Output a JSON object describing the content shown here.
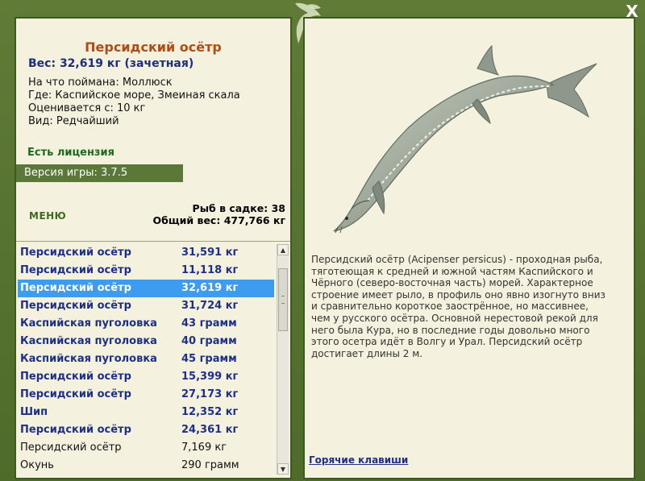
{
  "fish_card": {
    "title": "Персидский осётр",
    "weight": "Вес: 32,619 кг (зачетная)",
    "caught_on": "На что поймана: Моллюск",
    "location": "Где: Каспийское море, Змеиная скала",
    "valued_from": "Оценивается с: 10 кг",
    "kind": "Вид: Редчайший"
  },
  "license": "Есть лицензия",
  "version": "Версия игры: 3.7.5",
  "menu_label": "МЕНЮ",
  "stats": {
    "fish_count": "Рыб в садке: 38",
    "total_weight": "Общий вес: 477,766 кг"
  },
  "catch_list": [
    {
      "name": "Персидский осётр",
      "weight": "31,591 кг",
      "style": "bold"
    },
    {
      "name": "Персидский осётр",
      "weight": "11,118 кг",
      "style": "bold"
    },
    {
      "name": "Персидский осётр",
      "weight": "32,619 кг",
      "style": "selected"
    },
    {
      "name": "Персидский осётр",
      "weight": "31,724 кг",
      "style": "bold"
    },
    {
      "name": "Каспийская пуголовка",
      "weight": "43 грамм",
      "style": "bold"
    },
    {
      "name": "Каспийская пуголовка",
      "weight": "40 грамм",
      "style": "bold"
    },
    {
      "name": "Каспийская пуголовка",
      "weight": "45 грамм",
      "style": "bold"
    },
    {
      "name": "Персидский осётр",
      "weight": "15,399 кг",
      "style": "bold"
    },
    {
      "name": "Персидский осётр",
      "weight": "27,173 кг",
      "style": "bold"
    },
    {
      "name": "Шип",
      "weight": "12,352 кг",
      "style": "bold"
    },
    {
      "name": "Персидский осётр",
      "weight": "24,361 кг",
      "style": "bold"
    },
    {
      "name": "Персидский осётр",
      "weight": "7,169 кг",
      "style": "plain"
    },
    {
      "name": "Окунь",
      "weight": "290 грамм",
      "style": "plain"
    }
  ],
  "scroll": {
    "up_icon": "triangle-up-icon",
    "down_icon": "triangle-down-icon"
  },
  "description": "Персидский осётр (Acipenser persicus) - проходная рыба, тяготеющая к средней и южной частям Каспийского и Чёрного (северо-восточная часть) морей. Характерное строение имеет рыло, в профиль оно явно изогнуто вниз и сравнительно короткое заострённое, но массивнее, чем у русского осётра. Основной нерестовой рекой для него была Кура, но в последние годы довольно много этого осетра идёт в Волгу и Урал. Персидский осётр достигает длины 2 м.",
  "hotkeys_link": "Горячие клавиши",
  "close_label": "X",
  "colors": {
    "frame": "#55702f",
    "panel": "#f4f2df",
    "title": "#b24c14",
    "list_text": "#1e2f86",
    "selection": "#3d9bf0",
    "version_bar": "#5b7838"
  }
}
